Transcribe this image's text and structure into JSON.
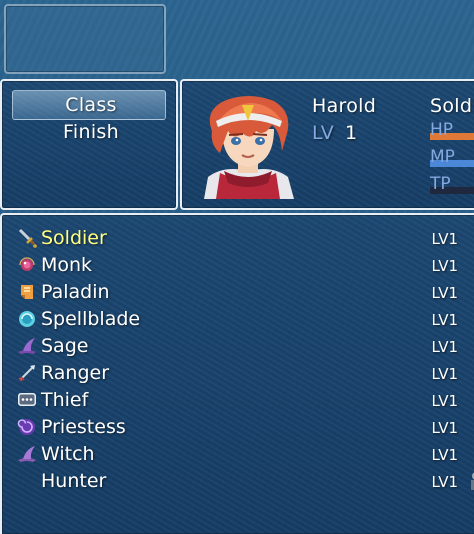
{
  "commands": {
    "class_label": "Class",
    "finish_label": "Finish"
  },
  "actor": {
    "name": "Harold",
    "class_partial": "Soldi",
    "level_label": "LV",
    "level_value": "1",
    "hp_label": "HP",
    "mp_label": "MP",
    "tp_label": "TP",
    "hp_ratio": 1.0,
    "mp_ratio": 1.0,
    "tp_ratio": 0.0
  },
  "classes": [
    {
      "name": "Soldier",
      "level": "LV1",
      "icon": "sword-icon",
      "selected": true
    },
    {
      "name": "Monk",
      "level": "LV1",
      "icon": "prayer-bead-icon",
      "selected": false
    },
    {
      "name": "Paladin",
      "level": "LV1",
      "icon": "holy-scroll-icon",
      "selected": false
    },
    {
      "name": "Spellblade",
      "level": "LV1",
      "icon": "magic-orb-icon",
      "selected": false
    },
    {
      "name": "Sage",
      "level": "LV1",
      "icon": "wizard-hat-icon",
      "selected": false
    },
    {
      "name": "Ranger",
      "level": "LV1",
      "icon": "arrow-icon",
      "selected": false
    },
    {
      "name": "Thief",
      "level": "LV1",
      "icon": "speech-bubble-icon",
      "selected": false
    },
    {
      "name": "Priestess",
      "level": "LV1",
      "icon": "spiral-icon",
      "selected": false
    },
    {
      "name": "Witch",
      "level": "LV1",
      "icon": "witch-hat-icon",
      "selected": false
    },
    {
      "name": "Hunter",
      "level": "LV1",
      "icon": "",
      "selected": false
    }
  ],
  "colors": {
    "selected_text": "#ffff80",
    "normal_text": "#ffffff",
    "system_text": "#84a8e0",
    "hp_gauge": "#e07838",
    "mp_gauge": "#4c88d8",
    "tp_gauge": "#58b050"
  }
}
